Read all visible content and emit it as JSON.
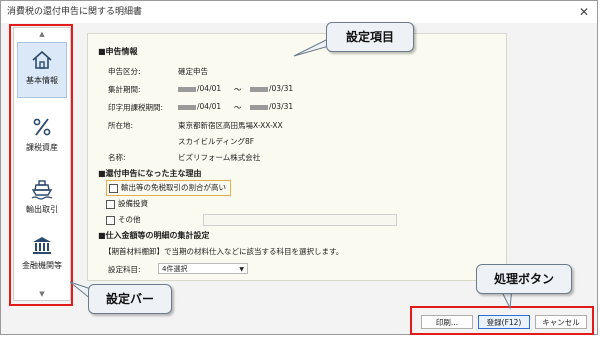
{
  "window": {
    "title": "消費税の還付申告に関する明細書",
    "close_glyph": "✕"
  },
  "sidebar": {
    "up_arrow": "▲",
    "down_arrow": "▼",
    "items": [
      {
        "label": "基本情報",
        "icon": "home-icon",
        "active": true
      },
      {
        "label": "課税資産",
        "icon": "percent-icon",
        "active": false
      },
      {
        "label": "輸出取引",
        "icon": "ship-icon",
        "active": false
      },
      {
        "label": "金融機関等",
        "icon": "bank-icon",
        "active": false
      }
    ]
  },
  "content": {
    "filing_section_title": "■申告情報",
    "filing_type_label": "申告区分:",
    "filing_type_value": "確定申告",
    "tax_period_label": "集計期間:",
    "tax_period_start": "/04/01",
    "tax_period_end": "/03/31",
    "tax_period_sep": "～",
    "print_period_label": "印字用課税期間:",
    "print_period_start": "/04/01",
    "print_period_end": "/03/31",
    "print_period_sep": "～",
    "address_label": "所在地:",
    "address_line1": "東京都新宿区高田馬場X-XX-XX",
    "address_line2": "スカイビルディング8F",
    "name_label": "名称:",
    "name_value": "ビズリフォーム株式会社",
    "refund_section_title": "■還付申告になった主な理由",
    "reason_options": [
      {
        "label": "輸出等の免税取引の割合が高い",
        "checked": false
      },
      {
        "label": "設備投資",
        "checked": false
      },
      {
        "label": "その他",
        "checked": false
      }
    ],
    "other_reason_value": "",
    "purchase_section_title": "■仕入金額等の明細の集計設定",
    "purchase_note": "【期首材料棚卸】で当期の材料仕入などに該当する科目を選択します。",
    "accounts_label": "設定科目:",
    "accounts_selected": "4件選択"
  },
  "buttons": {
    "print": "印刷...",
    "register": "登録(F12)",
    "cancel": "キャンセル"
  },
  "annotations": {
    "settings_items": "設定項目",
    "settings_bar": "設定バー",
    "process_buttons": "処理ボタン",
    "frame_color": "#e31a1a"
  }
}
